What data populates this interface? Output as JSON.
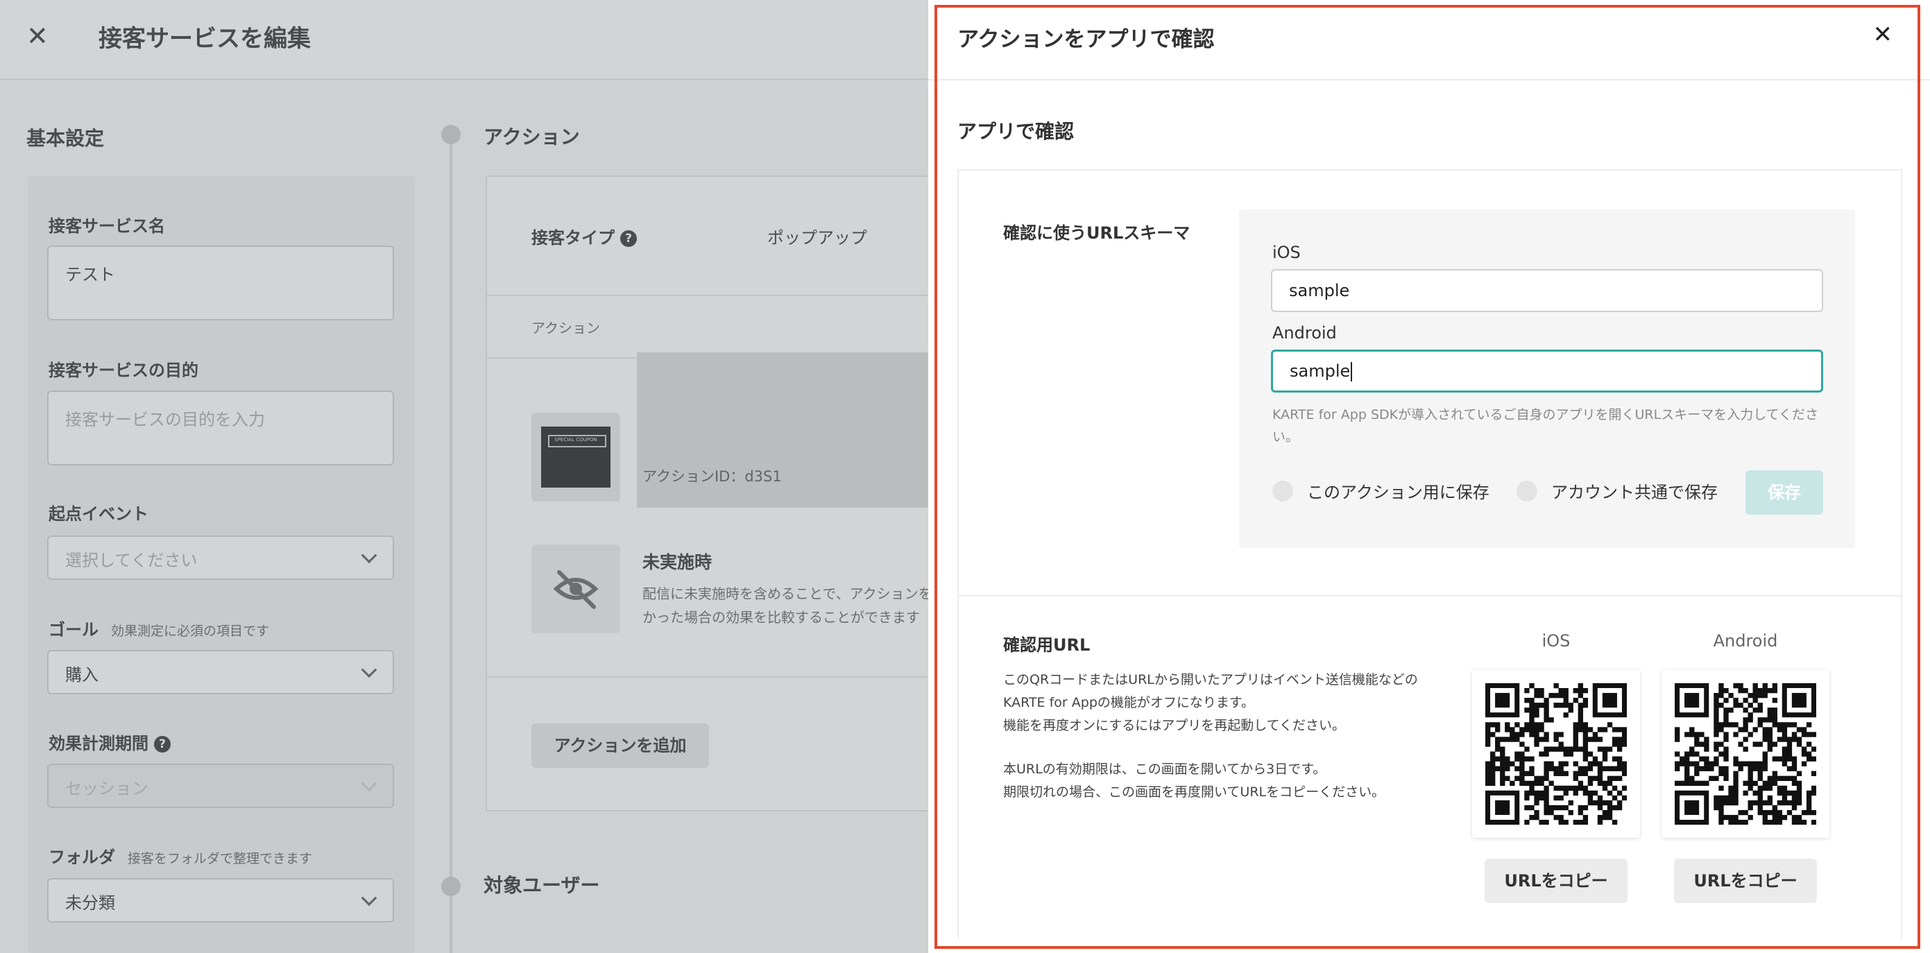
{
  "editor": {
    "title": "接客サービスを編集",
    "basic_settings_title": "基本設定",
    "fields": {
      "name_label": "接客サービス名",
      "name_value": "テスト",
      "purpose_label": "接客サービスの目的",
      "purpose_placeholder": "接客サービスの目的を入力",
      "start_event_label": "起点イベント",
      "start_event_placeholder": "選択してください",
      "goal_label": "ゴール",
      "goal_note": "効果測定に必須の項目です",
      "goal_value": "購入",
      "period_label": "効果計測期間",
      "period_value": "セッション",
      "folder_label": "フォルダ",
      "folder_note": "接客をフォルダで整理できます",
      "folder_value": "未分類"
    },
    "action_section_title": "アクション",
    "action_type_label": "接客タイプ",
    "action_type_value": "ポップアップ",
    "action_col_label": "アクション",
    "action_id": "アクションID：d3S1",
    "thumb_text": "SPECIAL COUPON",
    "unrun_title": "未実施時",
    "unrun_desc_line1": "配信に未実施時を含めることで、アクションを",
    "unrun_desc_line2": "かった場合の効果を比較することができます",
    "add_action_label": "アクションを追加",
    "target_users_title": "対象ユーザー"
  },
  "modal": {
    "title": "アクションをアプリで確認",
    "subtitle": "アプリで確認",
    "scheme": {
      "label": "確認に使うURLスキーマ",
      "ios_label": "iOS",
      "ios_value": "sample",
      "android_label": "Android",
      "android_value": "sample",
      "hint": "KARTE for App SDKが導入されているご自身のアプリを開くURLスキーマを入力してください。",
      "radio_action": "このアクション用に保存",
      "radio_account": "アカウント共通で保存",
      "save_label": "保存"
    },
    "confirm_url": {
      "title": "確認用URL",
      "desc_1": "このQRコードまたはURLから開いたアプリはイベント送信機能などの",
      "desc_2": "KARTE for Appの機能がオフになります。",
      "desc_3": "機能を再度オンにするにはアプリを再起動してください。",
      "desc_4": "本URLの有効期限は、この画面を開いてから3日です。",
      "desc_5": "期限切れの場合、この画面を再度開いてURLをコピーください。",
      "ios_label": "iOS",
      "android_label": "Android",
      "copy_label": "URLをコピー"
    }
  },
  "colors": {
    "accent": "#30a7a0",
    "save_disabled": "#c8e6e4",
    "highlight": "#e0492e"
  }
}
